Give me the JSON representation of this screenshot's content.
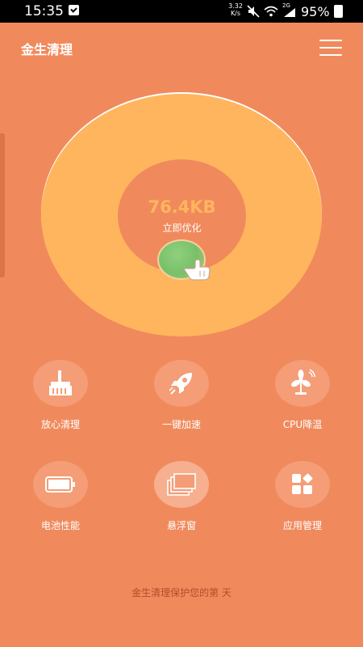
{
  "status_bar": {
    "time": "15:35",
    "net_speed_value": "3.32",
    "net_speed_unit": "K/s",
    "network": "2G",
    "battery": "95%"
  },
  "header": {
    "title": "金生清理"
  },
  "ring": {
    "value": "76.4KB",
    "label": "立即优化"
  },
  "features": [
    {
      "label": "放心清理",
      "icon": "broom-icon"
    },
    {
      "label": "一键加速",
      "icon": "rocket-icon"
    },
    {
      "label": "CPU降温",
      "icon": "fan-icon"
    },
    {
      "label": "电池性能",
      "icon": "battery-icon"
    },
    {
      "label": "悬浮窗",
      "icon": "floating-window-icon"
    },
    {
      "label": "应用管理",
      "icon": "app-grid-icon"
    }
  ],
  "footer": {
    "text": "金生清理保护您的第  天"
  },
  "colors": {
    "background": "#F08A5D",
    "ring": "#FFB55E",
    "feature_circle": "#F49D77",
    "footer_text": "#B04E28"
  }
}
